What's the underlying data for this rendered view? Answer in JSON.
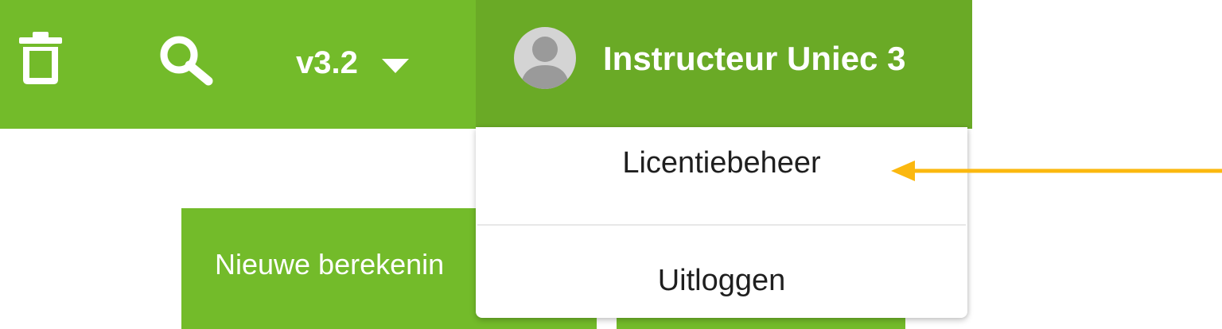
{
  "colors": {
    "brand_green": "#73bb2a",
    "user_button_green": "#6aaa26",
    "annotation_arrow": "#fbb80f"
  },
  "toolbar": {
    "delete_icon": "trash-icon",
    "search_icon": "search-icon",
    "version_label": "v3.2",
    "version_dropdown_icon": "caret-down-icon"
  },
  "user_menu": {
    "avatar_icon": "user-avatar-icon",
    "user_name": "Instructeur Uniec 3",
    "items": [
      {
        "label": "Licentiebeheer"
      },
      {
        "label": "Uitloggen"
      }
    ]
  },
  "main": {
    "new_calculation_button": "Nieuwe berekenin"
  },
  "annotation": {
    "arrow_icon": "arrow-left-icon"
  }
}
